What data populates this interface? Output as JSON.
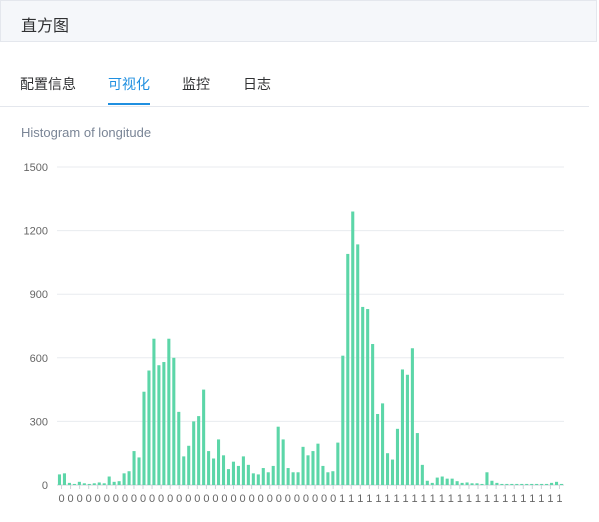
{
  "panel": {
    "title": "直方图"
  },
  "tabs": [
    {
      "label": "配置信息",
      "active": false
    },
    {
      "label": "可视化",
      "active": true
    },
    {
      "label": "监控",
      "active": false
    },
    {
      "label": "日志",
      "active": false
    }
  ],
  "colors": {
    "accent": "#1f8fe0",
    "bar": "#5cd6a8"
  },
  "chart_data": {
    "type": "bar",
    "title": "Histogram of longitude",
    "xlabel": "",
    "ylabel": "",
    "ylim": [
      0,
      1500
    ],
    "yticks": [
      "0",
      "300",
      "600",
      "900",
      "1200",
      "1500"
    ],
    "grid": true,
    "categories": [
      "0",
      "0",
      "0",
      "0",
      "0",
      "0",
      "0",
      "0",
      "0",
      "0",
      "0",
      "0",
      "0",
      "0",
      "0",
      "0",
      "0",
      "0",
      "0",
      "0",
      "0",
      "0",
      "0",
      "0",
      "0",
      "0",
      "0",
      "0",
      "0",
      "0",
      "0",
      "1",
      "1",
      "1",
      "1",
      "1",
      "1",
      "1",
      "1",
      "1",
      "1",
      "1",
      "1",
      "1",
      "1",
      "1",
      "1",
      "1",
      "1",
      "1",
      "1",
      "1",
      "1",
      "1",
      "1",
      "1"
    ],
    "values": [
      50,
      55,
      10,
      5,
      15,
      8,
      5,
      8,
      12,
      8,
      40,
      15,
      18,
      55,
      65,
      160,
      130,
      440,
      540,
      690,
      565,
      580,
      690,
      600,
      345,
      135,
      185,
      300,
      325,
      450,
      160,
      125,
      215,
      140,
      75,
      110,
      90,
      135,
      95,
      55,
      50,
      80,
      60,
      90,
      275,
      215,
      80,
      60,
      60,
      180,
      140,
      160,
      195,
      90,
      60,
      65,
      200,
      610,
      1090,
      1290,
      1135,
      840,
      830,
      665,
      335,
      385,
      150,
      120,
      265,
      545,
      520,
      645,
      245,
      95,
      20,
      10,
      35,
      40,
      30,
      30,
      18,
      10,
      12,
      8,
      8,
      5,
      60,
      20,
      10,
      5,
      5,
      5,
      5,
      5,
      5,
      5,
      5,
      5,
      5,
      10,
      15,
      5
    ]
  }
}
